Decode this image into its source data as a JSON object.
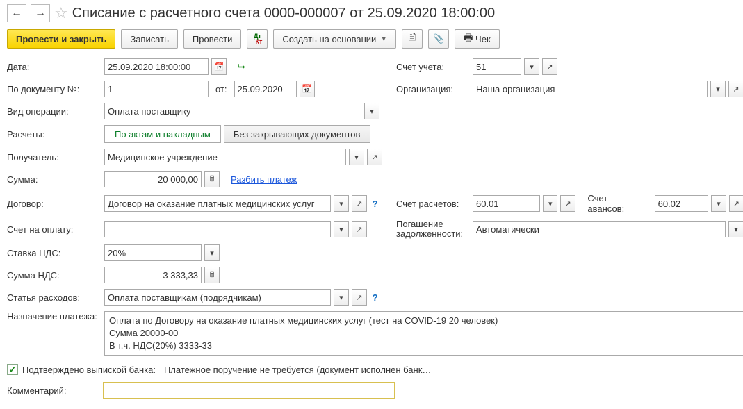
{
  "title": "Списание с расчетного счета 0000-000007 от 25.09.2020 18:00:00",
  "toolbar": {
    "post_close": "Провести и закрыть",
    "save": "Записать",
    "post": "Провести",
    "create_based": "Создать на основании",
    "cheque": "Чек"
  },
  "labels": {
    "date": "Дата:",
    "doc_no": "По документу №:",
    "doc_from": "от:",
    "op_type": "Вид операции:",
    "calc": "Расчеты:",
    "recipient": "Получатель:",
    "sum": "Сумма:",
    "contract": "Договор:",
    "invoice": "Счет на оплату:",
    "vat_rate": "Ставка НДС:",
    "vat_sum": "Сумма НДС:",
    "expense": "Статья расходов:",
    "purpose": "Назначение платежа:",
    "account": "Счет учета:",
    "org": "Организация:",
    "settle_acc": "Счет расчетов:",
    "advance_acc": "Счет авансов:",
    "debt": "Погашение задолженности:",
    "confirmed": "Подтверждено выпиской банка:",
    "confirmed_text": "Платежное поручение не требуется (документ исполнен банк…",
    "comment": "Комментарий:",
    "split": "Разбить платеж",
    "seg_acts": "По актам и накладным",
    "seg_nodocs": "Без закрывающих документов"
  },
  "values": {
    "date": "25.09.2020 18:00:00",
    "doc_no": "1",
    "doc_date": "25.09.2020",
    "op_type": "Оплата поставщику",
    "recipient": "Медицинское учреждение",
    "sum": "20 000,00",
    "contract": "Договор на оказание платных медицинских услуг",
    "vat_rate": "20%",
    "vat_sum": "3 333,33",
    "expense": "Оплата поставщикам (подрядчикам)",
    "purpose_l1": "Оплата по Договору на оказание платных медицинских услуг (тест на COVID-19 20 человек)",
    "purpose_l2": "Сумма 20000-00",
    "purpose_l3": "В т.ч. НДС(20%) 3333-33",
    "account": "51",
    "org": "Наша организация",
    "settle_acc": "60.01",
    "advance_acc": "60.02",
    "debt": "Автоматически",
    "confirmed": true
  }
}
